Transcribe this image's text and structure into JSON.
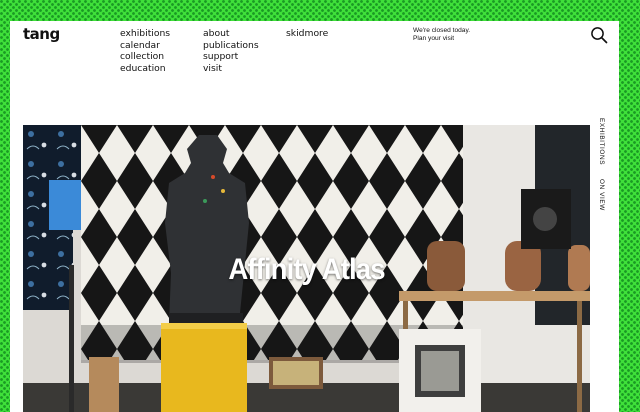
{
  "header": {
    "logo": "tang",
    "nav_columns": [
      [
        "exhibitions",
        "calendar",
        "collection",
        "education"
      ],
      [
        "about",
        "publications",
        "support",
        "visit"
      ],
      [
        "skidmore"
      ]
    ],
    "notice_line": "We're closed today.",
    "notice_link": "Plan your visit",
    "search_icon": "search-icon"
  },
  "side_tabs": [
    "EXHIBITIONS",
    "ON VIEW"
  ],
  "hero": {
    "title": "Affinity Atlas"
  },
  "colors": {
    "background": "#3fe03a",
    "pattern_dot": "#1a9a24",
    "panel": "#ffffff",
    "text": "#111111",
    "pedestal": "#e8b81e"
  }
}
